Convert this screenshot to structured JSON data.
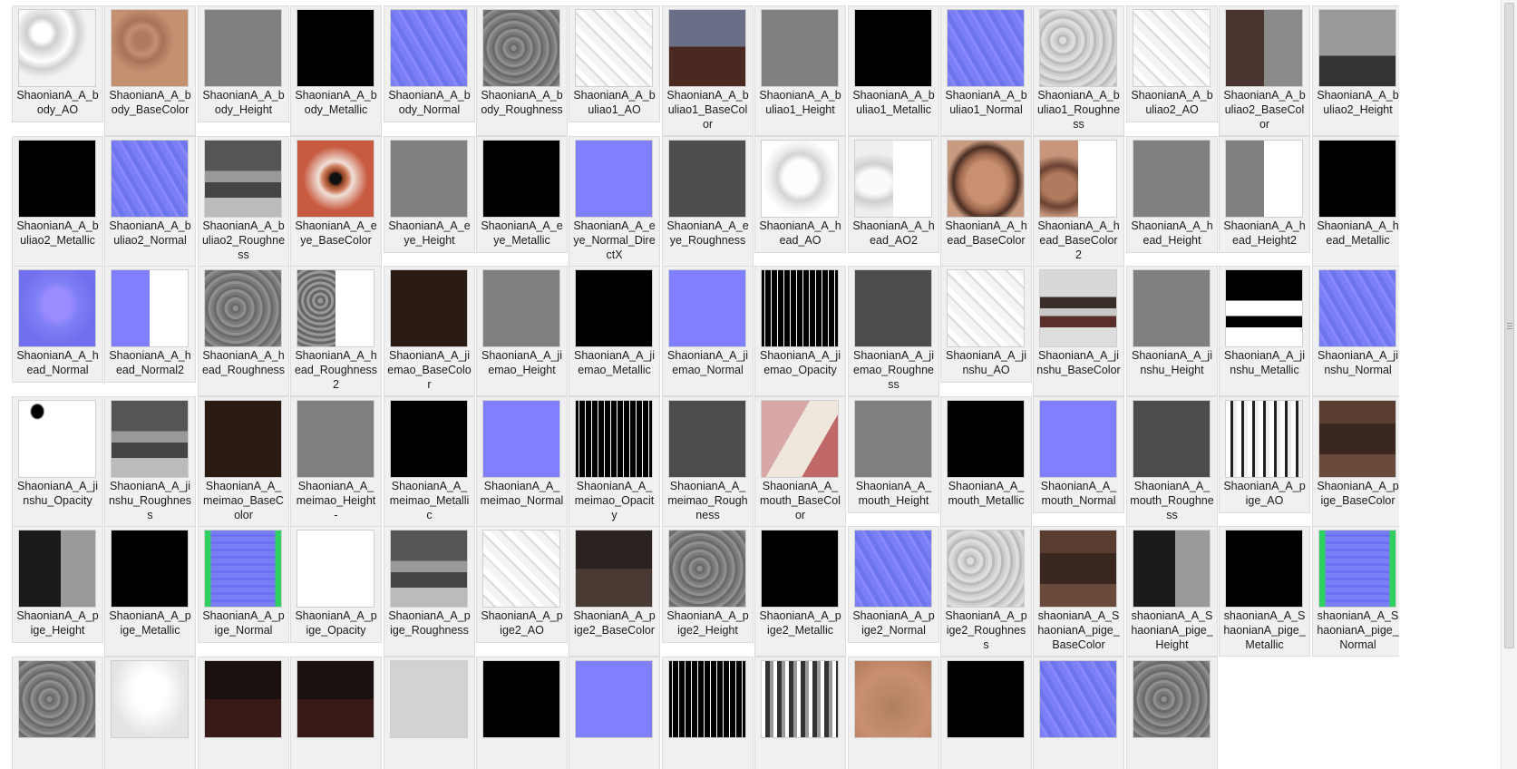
{
  "window": {
    "title": ""
  },
  "files": [
    {
      "name": "ShaonianA_A_body_AO",
      "thumb": "ao-hands"
    },
    {
      "name": "ShaonianA_A_body_BaseColor",
      "thumb": "skin-hands"
    },
    {
      "name": "ShaonianA_A_body_Height",
      "thumb": "gray"
    },
    {
      "name": "ShaonianA_A_body_Metallic",
      "thumb": "black"
    },
    {
      "name": "ShaonianA_A_body_Normal",
      "thumb": "normal"
    },
    {
      "name": "ShaonianA_A_body_Roughness",
      "thumb": "rough"
    },
    {
      "name": "ShaonianA_A_buliao1_AO",
      "thumb": "ao-white"
    },
    {
      "name": "ShaonianA_A_buliao1_BaseColor",
      "thumb": "cloth-color"
    },
    {
      "name": "ShaonianA_A_buliao1_Height",
      "thumb": "gray"
    },
    {
      "name": "ShaonianA_A_buliao1_Metallic",
      "thumb": "black"
    },
    {
      "name": "ShaonianA_A_buliao1_Normal",
      "thumb": "normal"
    },
    {
      "name": "ShaonianA_A_buliao1_Roughness",
      "thumb": "rough-light"
    },
    {
      "name": "ShaonianA_A_buliao2_AO",
      "thumb": "ao-white"
    },
    {
      "name": "ShaonianA_A_buliao2_BaseColor",
      "thumb": "brown-gray"
    },
    {
      "name": "ShaonianA_A_buliao2_Height",
      "thumb": "gray-split"
    },
    {
      "name": "ShaonianA_A_buliao2_Metallic",
      "thumb": "black"
    },
    {
      "name": "ShaonianA_A_buliao2_Normal",
      "thumb": "normal"
    },
    {
      "name": "ShaonianA_A_buliao2_Roughness",
      "thumb": "rough-blocks"
    },
    {
      "name": "ShaonianA_A_eye_BaseColor",
      "thumb": "eye"
    },
    {
      "name": "ShaonianA_A_eye_Height",
      "thumb": "gray"
    },
    {
      "name": "ShaonianA_A_eye_Metallic",
      "thumb": "black"
    },
    {
      "name": "ShaonianA_A_eye_Normal_DirectX",
      "thumb": "flat-normal"
    },
    {
      "name": "ShaonianA_A_eye_Roughness",
      "thumb": "dark-gray"
    },
    {
      "name": "ShaonianA_A_head_AO",
      "thumb": "face-ao"
    },
    {
      "name": "ShaonianA_A_head_AO2",
      "thumb": "face-ao-half"
    },
    {
      "name": "ShaonianA_A_head_BaseColor",
      "thumb": "face-color"
    },
    {
      "name": "ShaonianA_A_head_BaseColor2",
      "thumb": "face-color-half"
    },
    {
      "name": "ShaonianA_A_head_Height",
      "thumb": "gray"
    },
    {
      "name": "ShaonianA_A_head_Height2",
      "thumb": "gray-white-half"
    },
    {
      "name": "ShaonianA_A_head_Metallic",
      "thumb": "black"
    },
    {
      "name": "ShaonianA_A_head_Normal",
      "thumb": "face-normal"
    },
    {
      "name": "ShaonianA_A_head_Normal2",
      "thumb": "normal-white-half"
    },
    {
      "name": "ShaonianA_A_head_Roughness",
      "thumb": "rough"
    },
    {
      "name": "ShaonianA_A_head_Roughness2",
      "thumb": "rough-white-half"
    },
    {
      "name": "ShaonianA_A_jiemao_BaseColor",
      "thumb": "dark-brown"
    },
    {
      "name": "ShaonianA_A_jiemao_Height",
      "thumb": "gray"
    },
    {
      "name": "ShaonianA_A_jiemao_Metallic",
      "thumb": "black"
    },
    {
      "name": "ShaonianA_A_jiemao_Normal",
      "thumb": "flat-normal"
    },
    {
      "name": "ShaonianA_A_jiemao_Opacity",
      "thumb": "lashes"
    },
    {
      "name": "ShaonianA_A_jiemao_Roughness",
      "thumb": "dark-gray"
    },
    {
      "name": "ShaonianA_A_jinshu_AO",
      "thumb": "ao-white"
    },
    {
      "name": "ShaonianA_A_jinshu_BaseColor",
      "thumb": "metal-color"
    },
    {
      "name": "ShaonianA_A_jinshu_Height",
      "thumb": "gray"
    },
    {
      "name": "ShaonianA_A_jinshu_Metallic",
      "thumb": "metal-mask"
    },
    {
      "name": "ShaonianA_A_jinshu_Normal",
      "thumb": "normal"
    },
    {
      "name": "ShaonianA_A_jinshu_Opacity",
      "thumb": "white-dot"
    },
    {
      "name": "ShaonianA_A_jinshu_Roughness",
      "thumb": "rough-blocks"
    },
    {
      "name": "ShaonianA_A_meimao_BaseColor",
      "thumb": "dark-brown"
    },
    {
      "name": "ShaonianA_A_meimao_Height -",
      "thumb": "gray"
    },
    {
      "name": "ShaonianA_A_meimao_Metallic",
      "thumb": "black"
    },
    {
      "name": "ShaonianA_A_meimao_Normal",
      "thumb": "flat-normal"
    },
    {
      "name": "ShaonianA_A_meimao_Opacity",
      "thumb": "lashes"
    },
    {
      "name": "ShaonianA_A_meimao_Roughness",
      "thumb": "dark-gray"
    },
    {
      "name": "ShaonianA_A_mouth_BaseColor",
      "thumb": "mouth"
    },
    {
      "name": "ShaonianA_A_mouth_Height",
      "thumb": "gray"
    },
    {
      "name": "ShaonianA_A_mouth_Metallic",
      "thumb": "black"
    },
    {
      "name": "ShaonianA_A_mouth_Normal",
      "thumb": "flat-normal"
    },
    {
      "name": "ShaonianA_A_mouth_Roughness",
      "thumb": "dark-gray"
    },
    {
      "name": "ShaonianA_A_pige_AO",
      "thumb": "pige-ao"
    },
    {
      "name": "ShaonianA_A_pige_BaseColor",
      "thumb": "leather"
    },
    {
      "name": "ShaonianA_A_pige_Height",
      "thumb": "dark-split"
    },
    {
      "name": "ShaonianA_A_pige_Metallic",
      "thumb": "black"
    },
    {
      "name": "ShaonianA_A_pige_Normal",
      "thumb": "normal-green"
    },
    {
      "name": "ShaonianA_A_pige_Opacity",
      "thumb": "white"
    },
    {
      "name": "ShaonianA_A_pige_Roughness",
      "thumb": "rough-blocks"
    },
    {
      "name": "ShaonianA_A_pige2_AO",
      "thumb": "ao-white"
    },
    {
      "name": "ShaonianA_A_pige2_BaseColor",
      "thumb": "dark-leather"
    },
    {
      "name": "ShaonianA_A_pige2_Height",
      "thumb": "rough"
    },
    {
      "name": "ShaonianA_A_pige2_Metallic",
      "thumb": "black"
    },
    {
      "name": "ShaonianA_A_pige2_Normal",
      "thumb": "normal"
    },
    {
      "name": "ShaonianA_A_pige2_Roughness",
      "thumb": "rough-light"
    },
    {
      "name": "shaonianA_A_ShaonianA_pige_BaseColor",
      "thumb": "leather"
    },
    {
      "name": "shaonianA_A_ShaonianA_pige_Height",
      "thumb": "dark-split"
    },
    {
      "name": "shaonianA_A_ShaonianA_pige_Metallic",
      "thumb": "black"
    },
    {
      "name": "shaonianA_A_ShaonianA_pige_Normal",
      "thumb": "normal-green"
    },
    {
      "name": "",
      "thumb": "rough"
    },
    {
      "name": "",
      "thumb": "white-glow"
    },
    {
      "name": "",
      "thumb": "dark-red"
    },
    {
      "name": "",
      "thumb": "dark-red"
    },
    {
      "name": "",
      "thumb": "light-gray"
    },
    {
      "name": "",
      "thumb": "black"
    },
    {
      "name": "",
      "thumb": "flat-normal"
    },
    {
      "name": "",
      "thumb": "lashes"
    },
    {
      "name": "",
      "thumb": "stripes"
    },
    {
      "name": "",
      "thumb": "skin"
    },
    {
      "name": "",
      "thumb": "black"
    },
    {
      "name": "",
      "thumb": "normal"
    },
    {
      "name": "",
      "thumb": "rough"
    }
  ]
}
